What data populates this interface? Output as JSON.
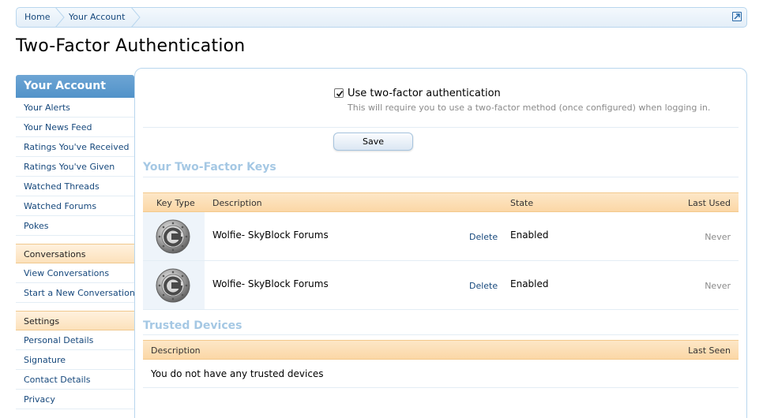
{
  "breadcrumb": {
    "items": [
      "Home",
      "Your Account"
    ]
  },
  "page": {
    "title": "Two-Factor Authentication"
  },
  "sidebar": {
    "heading": "Your Account",
    "group1": [
      "Your Alerts",
      "Your News Feed",
      "Ratings You've Received",
      "Ratings You've Given",
      "Watched Threads",
      "Watched Forums",
      "Pokes"
    ],
    "section_conversations": "Conversations",
    "group2": [
      "View Conversations",
      "Start a New Conversation"
    ],
    "section_settings": "Settings",
    "group3": [
      "Personal Details",
      "Signature",
      "Contact Details",
      "Privacy"
    ]
  },
  "twofactor": {
    "enabled": true,
    "checkbox_label": "Use two-factor authentication",
    "hint": "This will require you to use a two-factor method (once configured) when logging in.",
    "save_label": "Save"
  },
  "keys": {
    "title": "Your Two-Factor Keys",
    "columns": [
      "Key Type",
      "Description",
      "State",
      "Last Used"
    ],
    "rows": [
      {
        "icon": "google-authenticator-icon",
        "description": "Wolfie- SkyBlock Forums",
        "action": "Delete",
        "state": "Enabled",
        "last_used": "Never"
      },
      {
        "icon": "google-authenticator-icon",
        "description": "Wolfie- SkyBlock Forums",
        "action": "Delete",
        "state": "Enabled",
        "last_used": "Never"
      }
    ]
  },
  "trusted": {
    "title": "Trusted Devices",
    "columns": [
      "Description",
      "Last Seen"
    ],
    "empty": "You do not have any trusted devices"
  },
  "colors": {
    "link": "#16487c",
    "sidebar_header": "#5c9bd0",
    "section_title": "#a5c8e4",
    "table_header": "#fbdcb0"
  }
}
